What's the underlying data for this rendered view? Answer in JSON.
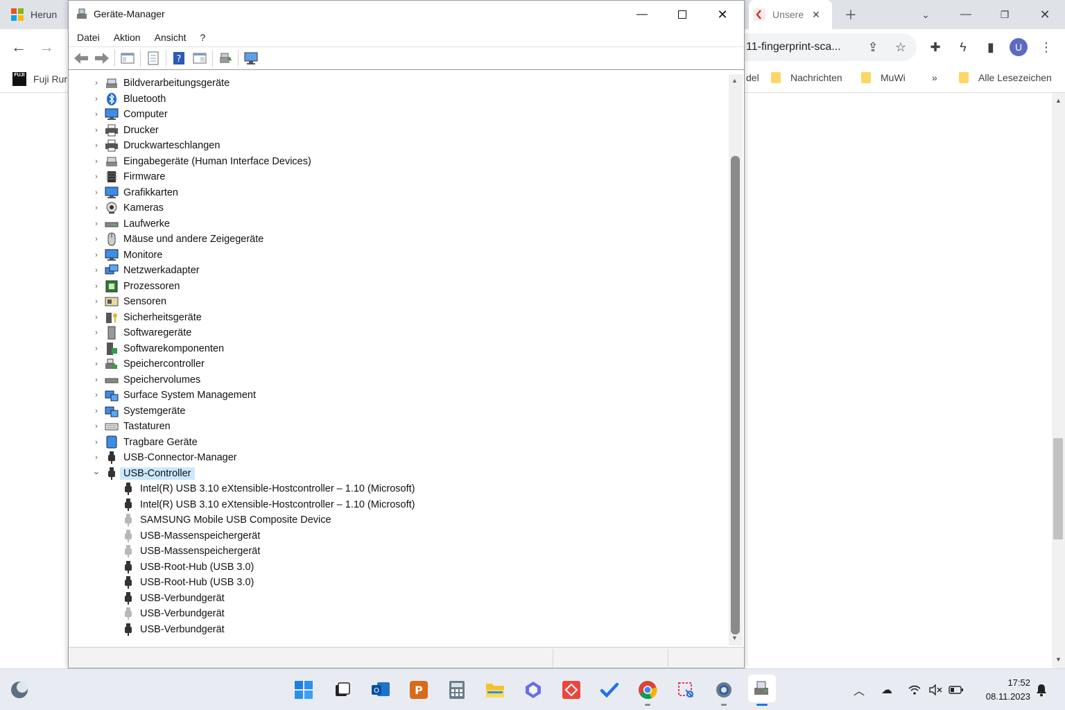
{
  "browser": {
    "tab_left_label": "Herun",
    "tab_right_label": "Unsere",
    "omnibox_text": "11-fingerprint-sca...",
    "profile_initial": "U",
    "bookmarks": {
      "left_label": "Fuji Rur",
      "partial_label": "del",
      "items": [
        "Nachrichten",
        "MuWi"
      ],
      "more_label": "»",
      "all_label": "Alle Lesezeichen"
    }
  },
  "window": {
    "title": "Geräte-Manager",
    "menu": [
      "Datei",
      "Aktion",
      "Ansicht",
      "?"
    ]
  },
  "tree": {
    "categories": [
      "Bildverarbeitungsgeräte",
      "Bluetooth",
      "Computer",
      "Drucker",
      "Druckwarteschlangen",
      "Eingabegeräte (Human Interface Devices)",
      "Firmware",
      "Grafikkarten",
      "Kameras",
      "Laufwerke",
      "Mäuse und andere Zeigegeräte",
      "Monitore",
      "Netzwerkadapter",
      "Prozessoren",
      "Sensoren",
      "Sicherheitsgeräte",
      "Softwaregeräte",
      "Softwarekomponenten",
      "Speichercontroller",
      "Speichervolumes",
      "Surface System Management",
      "Systemgeräte",
      "Tastaturen",
      "Tragbare Geräte",
      "USB-Connector-Manager",
      "USB-Controller"
    ],
    "expanded_category": "USB-Controller",
    "usb_children": [
      "Intel(R) USB 3.10 eXtensible-Hostcontroller – 1.10 (Microsoft)",
      "Intel(R) USB 3.10 eXtensible-Hostcontroller – 1.10 (Microsoft)",
      "SAMSUNG Mobile USB Composite Device",
      "USB-Massenspeichergerät",
      "USB-Massenspeichergerät",
      "USB-Root-Hub (USB 3.0)",
      "USB-Root-Hub (USB 3.0)",
      "USB-Verbundgerät",
      "USB-Verbundgerät",
      "USB-Verbundgerät"
    ],
    "usb_children_grayed": [
      false,
      false,
      true,
      true,
      true,
      false,
      false,
      false,
      true,
      false
    ]
  },
  "taskbar": {
    "apps": [
      "start-icon",
      "task-view-icon",
      "outlook-icon",
      "presenter-icon",
      "calculator-icon",
      "explorer-icon",
      "copilot-icon",
      "anydesk-icon",
      "todo-icon",
      "chrome-icon",
      "snipping-icon",
      "settings-icon",
      "device-manager-icon"
    ],
    "time": "17:52",
    "date": "08.11.2023"
  },
  "colors": {
    "selection": "#cce8ff",
    "taskbar": "#e8ecf2",
    "tabstrip": "#dfe3e8"
  }
}
